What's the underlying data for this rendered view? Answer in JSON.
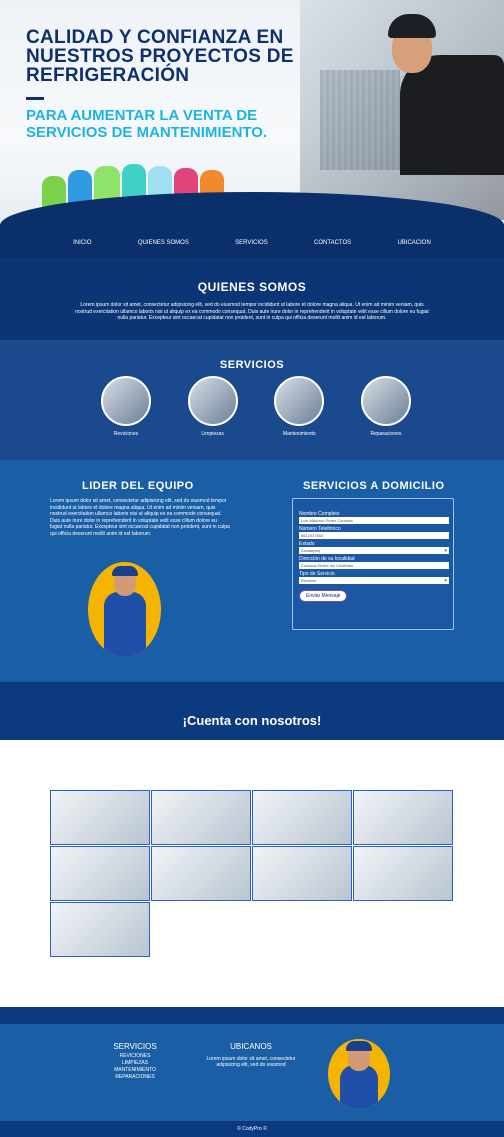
{
  "hero": {
    "title": "CALIDAD Y CONFIANZA EN NUESTROS PROYECTOS DE REFRIGERACIÓN",
    "subtitle": "PARA AUMENTAR LA VENTA DE SERVICIOS DE MANTENIMIENTO."
  },
  "nav": {
    "items": [
      "INICIO",
      "QUIENES SOMOS",
      "SERVICIOS",
      "CONTACTOS",
      "UBICACION"
    ]
  },
  "quienes": {
    "title": "QUIENES SOMOS",
    "text": "Lorem ipsum dolor sit amet, consectetur adipisicing elit, sed do eiusmod tempor incididunt ut labore et dolore magna aliqua. Ut enim ad minim veniam, quis nostrud exercitation ullamco laboris nisi ut aliquip ex ea commodo consequat. Duis aute irure dolor in reprehenderit in voluptate velit esse cillum dolore eu fugiat nulla pariatur. Excepteur sint occaecat cupidatat non proident, sunt in culpa qui officia deserunt mollit anim id est laborum."
  },
  "servicios": {
    "title": "SERVICIOS",
    "items": [
      "Reviciones",
      "Limpiezas",
      "Mantenimiento",
      "Reparaciones"
    ]
  },
  "lider": {
    "title": "LIDER DEL EQUIPO",
    "text": "Lorem ipsum dolor sit amet, consectetur adipisicing elit, sed do eiusmod tempor incididunt ut labore et dolore magna aliqua. Ut enim ad minim veniam, quis nostrud exercitation ullamco laboris nisi ut aliquip ex ea commodo consequat. Duis aute irure dolor in reprehenderit in voluptate velit esse cillum dolore eu fugiat nulla pariatur. Excepteur sint occaecat cupidatat non proident, sunt in culpa qui officia deserunt mollit anim id est laborum."
  },
  "domicilio": {
    "title": "SERVICIOS A DOMICILIO",
    "fields": {
      "name_label": "Nombre Completo",
      "name_value": "Luis Mauricio Perez Cordoba",
      "phone_label": "Número Telefónico",
      "phone_value": "6612037602",
      "state_label": "Estado",
      "state_value": "Zacatepeq",
      "address_label": "Dirección de su localidad",
      "address_value": "Curitana Sector los Chatimas",
      "type_label": "Tipo de Servicio",
      "type_value": "Revisión"
    },
    "submit": "Enviar Mensaje"
  },
  "cuenta": {
    "title": "¡Cuenta con nosotros!"
  },
  "footer": {
    "servicios_title": "SERVICIOS",
    "servicios_items": [
      "REVICIONES",
      "LIMPIEZAS",
      "MANTENIMIENTO",
      "REPARACIONES"
    ],
    "ubicanos_title": "UBICANOS",
    "ubicanos_text": "Lorem ipsum dolor sit amet, consectetur adipisicing elit, sed do eiusmod",
    "copyright": "© CodyPro ©"
  },
  "colors": {
    "navy": "#0b2f6b",
    "blue": "#1a5fa6",
    "accent_cyan": "#1cb4e6",
    "yellow": "#f4b400"
  }
}
